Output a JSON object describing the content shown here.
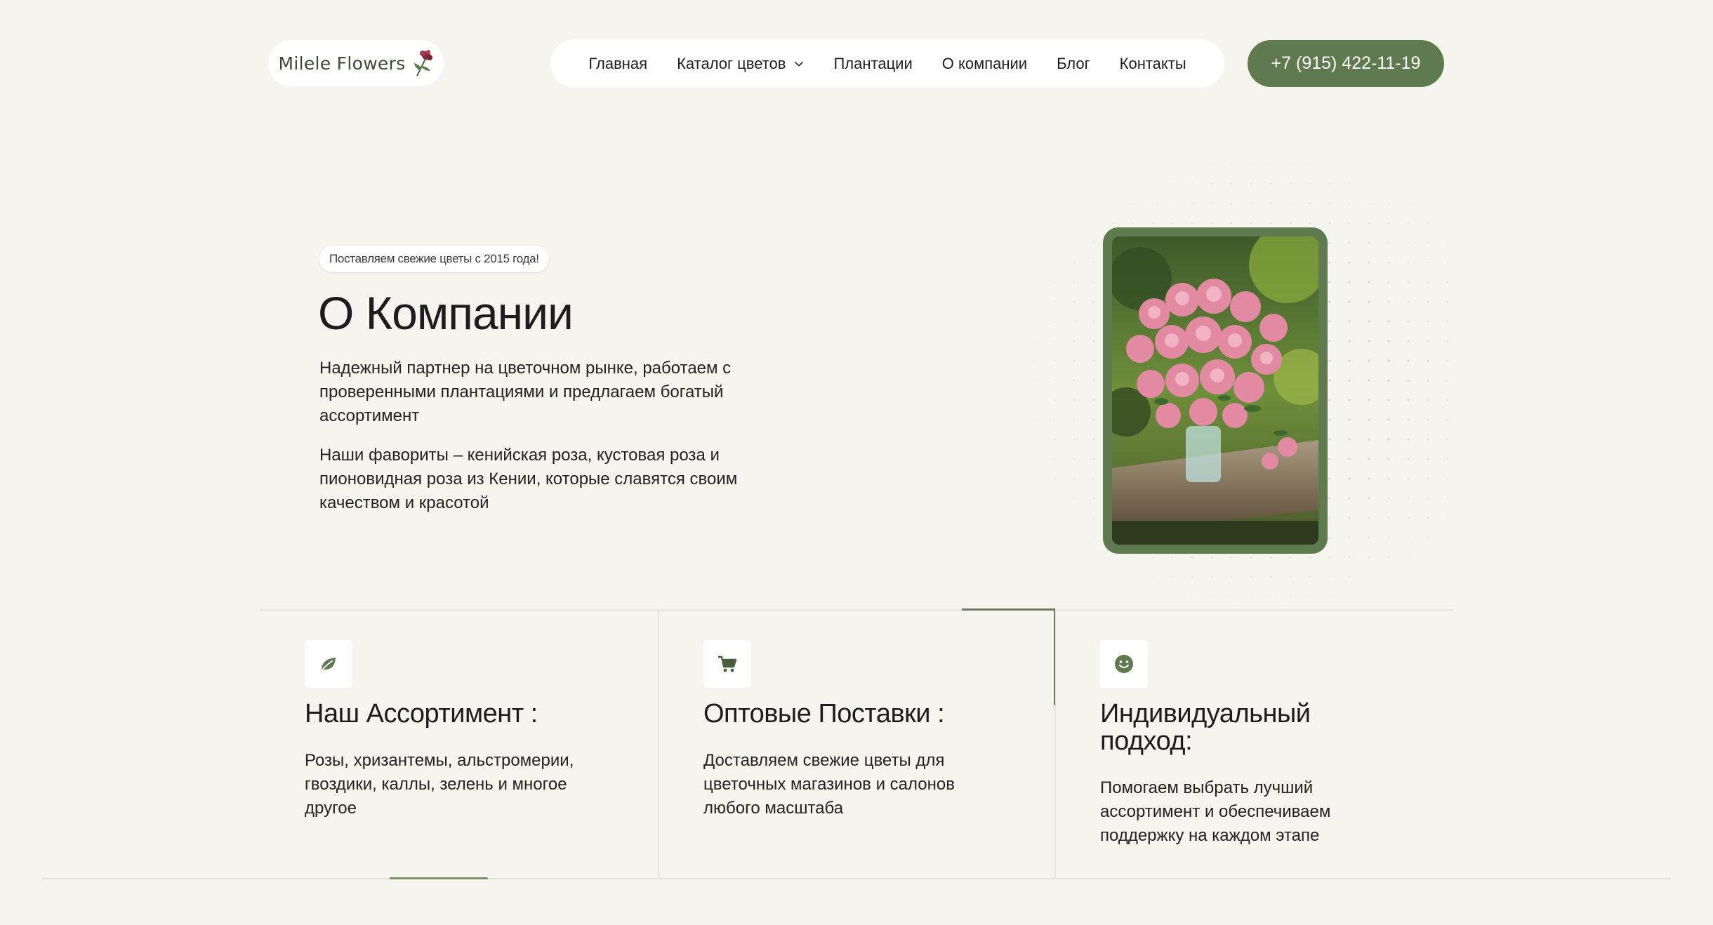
{
  "header": {
    "logo_text": "Milele Flowers",
    "nav": [
      {
        "label": "Главная"
      },
      {
        "label": "Каталог цветов",
        "has_dropdown": true
      },
      {
        "label": "Плантации"
      },
      {
        "label": "О компании"
      },
      {
        "label": "Блог"
      },
      {
        "label": "Контакты"
      }
    ],
    "phone": "+7 (915) 422-11-19"
  },
  "hero": {
    "badge": "Поставляем свежие цветы с 2015 года!",
    "title": "О Компании",
    "paragraph_1": "Надежный партнер на цветочном рынке, работаем с проверенными плантациями и предлагаем богатый ассортимент",
    "paragraph_2": "Наши фавориты – кенийская роза, кустовая роза и пионовидная роза из Кении, которые славятся своим качеством и красотой",
    "image": "pink-roses-bouquet-photo"
  },
  "features": [
    {
      "icon": "leaf-icon",
      "title": "Наш Ассортимент :",
      "text": "Розы, хризантемы, альстромерии, гвоздики, каллы, зелень и многое другое"
    },
    {
      "icon": "cart-icon",
      "title": "Оптовые Поставки :",
      "text": "Доставляем свежие цветы для цветочных магазинов и салонов любого масштаба"
    },
    {
      "icon": "smile-icon",
      "title": "Индивидуальный подход:",
      "text": "Помогаем выбрать лучший ассортимент и обеспечиваем поддержку на каждом этапе"
    }
  ],
  "colors": {
    "background": "#f6f4ee",
    "accent_green": "#5f7a4e",
    "white": "#ffffff",
    "text": "#1f1f1f"
  }
}
